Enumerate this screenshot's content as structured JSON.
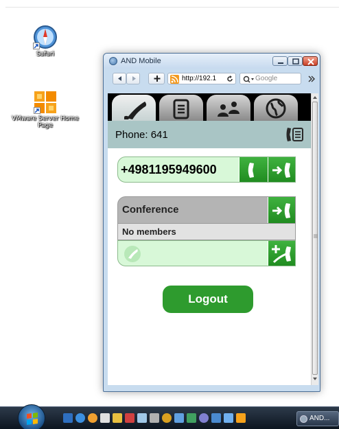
{
  "desktop": {
    "icons": [
      {
        "label": "Safari",
        "icon": "safari-icon"
      },
      {
        "label": "VMware Server Home Page",
        "icon": "vmware-icon"
      }
    ]
  },
  "window": {
    "title": "AND Mobile",
    "toolbar": {
      "url": "http://192.1",
      "search_placeholder": "Google"
    }
  },
  "app": {
    "tabs": [
      {
        "icon": "phone-icon",
        "active": true
      },
      {
        "icon": "notes-icon",
        "active": false
      },
      {
        "icon": "contacts-icon",
        "active": false
      },
      {
        "icon": "globe-icon",
        "active": false
      }
    ],
    "phone_label": "Phone: 641",
    "dial_number": "+4981195949600",
    "conference": {
      "title": "Conference",
      "members": "No members"
    },
    "logout_label": "Logout"
  },
  "colors": {
    "accent_green": "#2e9b2e",
    "header_teal": "#a9c5c5",
    "input_green": "#d8f8d8"
  },
  "taskbar": {
    "active_task": "AND..."
  }
}
